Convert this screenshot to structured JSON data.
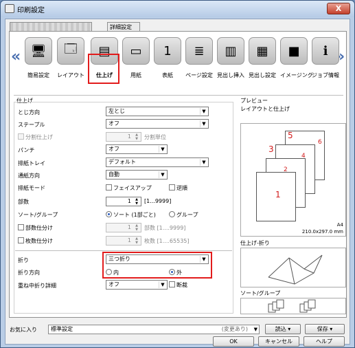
{
  "window": {
    "title": "印刷設定",
    "close_label": "X"
  },
  "tabs": {
    "hidden_label": "",
    "detail_label": "詳細設定"
  },
  "toolbar": {
    "items": [
      {
        "label": "簡易設定"
      },
      {
        "label": "レイアウト"
      },
      {
        "label": "仕上げ"
      },
      {
        "label": "用紙"
      },
      {
        "label": "表紙"
      },
      {
        "label": "ページ設定"
      },
      {
        "label": "見出し挿入"
      },
      {
        "label": "見出し設定"
      },
      {
        "label": "イメージング"
      },
      {
        "label": "ジョブ情報"
      }
    ],
    "left_arrow": "«",
    "right_arrow": "»"
  },
  "finishing": {
    "group_title": "仕上げ",
    "binding_label": "とじ方向",
    "binding_value": "左とじ",
    "staple_label": "ステープル",
    "staple_value": "オフ",
    "split_label": "分割仕上げ",
    "split_value": "1",
    "split_unit": "分割単位",
    "punch_label": "パンチ",
    "punch_value": "オフ",
    "output_tray_label": "排紙トレイ",
    "output_tray_value": "デフォルト",
    "feed_dir_label": "通紙方向",
    "feed_dir_value": "自動",
    "output_mode_label": "排紙モード",
    "faceup_label": "フェイスアップ",
    "reverse_label": "逆順",
    "copies_label": "部数",
    "copies_value": "1",
    "copies_range": "[1...9999]",
    "sort_label": "ソート/グループ",
    "sort_option": "ソート (1部ごと)",
    "group_option": "グループ",
    "set_split_label": "部数仕分け",
    "set_split_value": "1",
    "set_split_range": "部数 [1....9999]",
    "sheet_split_label": "枚数仕分け",
    "sheet_split_value": "1",
    "sheet_split_range": "枚数 [1....65535]",
    "fold_label": "折り",
    "fold_value": "三つ折り",
    "fold_dir_label": "折り方向",
    "fold_in": "内",
    "fold_out": "外",
    "overlap_fold_label": "重ね中折り詳細",
    "overlap_fold_value": "オフ",
    "cut_label": "断裁"
  },
  "preview": {
    "title": "プレビュー",
    "subtitle": "レイアウトと仕上げ",
    "paper_size": "A4",
    "paper_dims": "210.0x297.0 mm",
    "page_numbers": [
      "5",
      "6",
      "3",
      "4",
      "1",
      "2"
    ],
    "fold_title": "仕上げ-折り",
    "sort_title": "ソート/グループ"
  },
  "bottom": {
    "favorites_label": "お気に入り",
    "favorites_value": "標準設定",
    "favorites_status": "(変更あり)",
    "load_label": "読込",
    "save_label": "保存",
    "ok_label": "OK",
    "cancel_label": "キャンセル",
    "help_label": "ヘルプ"
  },
  "colors": {
    "highlight": "#e21b1b",
    "arrow": "#4a6fb0",
    "title_bar": "#b6cbe6"
  }
}
